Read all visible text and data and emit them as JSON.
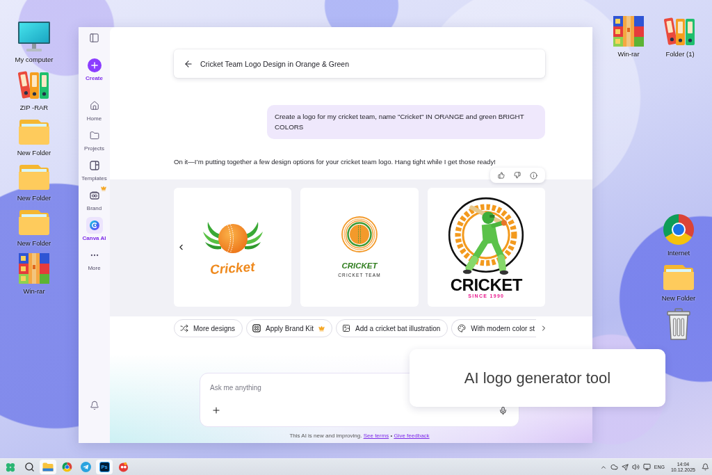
{
  "desktop": {
    "left_icons": [
      {
        "kind": "monitor",
        "label": "My computer"
      },
      {
        "kind": "binders",
        "label": "ZIP -RAR"
      },
      {
        "kind": "folder",
        "label": "New Folder"
      },
      {
        "kind": "folder",
        "label": "New Folder"
      },
      {
        "kind": "folder",
        "label": "New Folder"
      },
      {
        "kind": "winrar",
        "label": "Win-rar"
      }
    ],
    "top_right_icons": [
      {
        "kind": "winrar",
        "label": "Win-rar"
      },
      {
        "kind": "binders",
        "label": "Folder (1)"
      }
    ],
    "right_icons": [
      {
        "kind": "chrome",
        "label": "Internet"
      },
      {
        "kind": "folder",
        "label": "New Folder"
      },
      {
        "kind": "trash"
      }
    ]
  },
  "sidebar": {
    "items": [
      {
        "kind": "create",
        "label": "Create",
        "selected": false,
        "premium": false
      },
      {
        "kind": "home",
        "label": "Home",
        "selected": false,
        "premium": false
      },
      {
        "kind": "projects",
        "label": "Projects",
        "selected": false,
        "premium": false
      },
      {
        "kind": "templates",
        "label": "Templates",
        "selected": false,
        "premium": false
      },
      {
        "kind": "brand",
        "label": "Brand",
        "selected": false,
        "premium": true
      },
      {
        "kind": "canva-ai",
        "label": "Canva AI",
        "selected": true,
        "premium": false
      },
      {
        "kind": "more",
        "label": "More",
        "selected": false,
        "premium": false
      }
    ]
  },
  "chat": {
    "title": "Cricket Team Logo Design in Orange & Green",
    "user_message": "Create a logo for my cricket team, name \"Cricket\" IN ORANGE and green BRIGHT COLORS",
    "reply": "On it—I’m putting together a few design options for your cricket team logo. Hang tight while I get those ready!",
    "designs": [
      {
        "kind": "ball-wings",
        "title": "Cricket"
      },
      {
        "kind": "ring-ball",
        "title": "CRICKET",
        "subtitle": "CRICKET TEAM"
      },
      {
        "kind": "batsman",
        "title": "CRICKET",
        "subtitle": "SINCE 1990"
      }
    ],
    "suggestions": [
      {
        "kind": "shuffle",
        "label": "More designs",
        "premium": false
      },
      {
        "kind": "brand-kit",
        "label": "Apply Brand Kit",
        "premium": true
      },
      {
        "kind": "image",
        "label": "Add a cricket bat illustration",
        "premium": false
      },
      {
        "kind": "palette",
        "label": "With modern color st",
        "premium": false
      }
    ],
    "input": {
      "placeholder": "Ask me anything"
    },
    "disclaimer": {
      "text": "This AI is new and improving.",
      "links": [
        "See terms",
        "Give feedback"
      ],
      "separator": "•"
    }
  },
  "caption": "AI logo generator tool",
  "taskbar": {
    "apps": [
      {
        "kind": "start",
        "active": false
      },
      {
        "kind": "search",
        "active": false
      },
      {
        "kind": "explorer",
        "active": true
      },
      {
        "kind": "chrome",
        "active": false
      },
      {
        "kind": "telegram",
        "active": false
      },
      {
        "kind": "photoshop",
        "label": "Ps",
        "active": true
      },
      {
        "kind": "app",
        "active": false
      }
    ],
    "language": "ENG",
    "time": "14:04",
    "date": "10.12.2025"
  }
}
